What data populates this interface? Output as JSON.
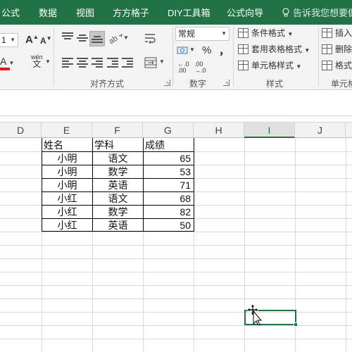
{
  "ribbon_tabs": [
    "公式",
    "数据",
    "视图",
    "方方格子",
    "DIY工具箱",
    "公式向导",
    "告诉我您想要做"
  ],
  "font": {
    "size_value": "1",
    "grow_label": "A",
    "shrink_label": "A",
    "color_label": "A",
    "phonetic_top": "wén",
    "phonetic_bottom": "文"
  },
  "alignment": {
    "group_label": "对齐方式"
  },
  "number": {
    "group_label": "数字",
    "format_value": "常规",
    "percent_label": "%",
    "comma_label": "，",
    "increase_decimal_label": "←.0\n.00",
    "decrease_decimal_label": ".00\n→.0"
  },
  "styles": {
    "group_label": "样式",
    "conditional_formatting": "条件格式",
    "format_as_table": "套用表格格式",
    "cell_styles": "单元格样式"
  },
  "cells": {
    "group_label": "单元格",
    "insert": "插入",
    "delete": "删除",
    "format": "格式"
  },
  "columns": [
    "D",
    "E",
    "F",
    "G",
    "H",
    "I",
    "J"
  ],
  "active_column": "I",
  "table": {
    "headers": [
      "姓名",
      "学科",
      "成绩"
    ],
    "rows": [
      [
        "小明",
        "语文",
        "65"
      ],
      [
        "小明",
        "数学",
        "53"
      ],
      [
        "小明",
        "英语",
        "71"
      ],
      [
        "小红",
        "语文",
        "68"
      ],
      [
        "小红",
        "数学",
        "82"
      ],
      [
        "小红",
        "英语",
        "50"
      ]
    ]
  },
  "colors": {
    "accent": "#217346",
    "ribbon_bg": "#f3f3f3",
    "font_color_bar": "#e81123"
  }
}
